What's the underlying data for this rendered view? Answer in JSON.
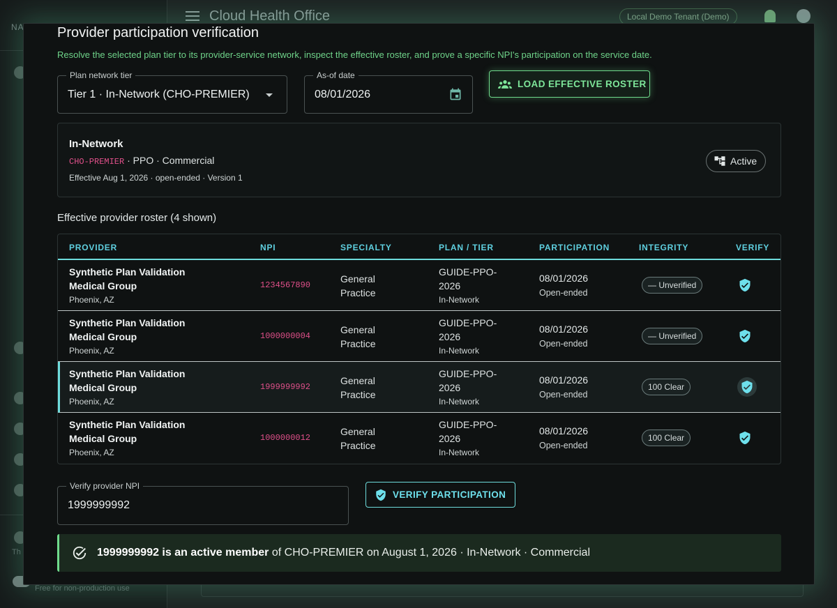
{
  "app": {
    "title": "Cloud Health Office",
    "tenant": "Local Demo Tenant (Demo)",
    "nav_label": "NA",
    "sidebar_footer_line1": "Th",
    "sidebar_footer_line2": "Free for non-production use"
  },
  "dialog": {
    "title": "Provider participation verification",
    "subtitle": "Resolve the selected plan tier to its provider-service network, inspect the effective roster, and prove a specific NPI's participation on the service date.",
    "plan_tier": {
      "label": "Plan network tier",
      "value": "Tier 1 · In-Network (CHO-PREMIER)"
    },
    "as_of": {
      "label": "As-of date",
      "value": "08/01/2026"
    },
    "load_button": "LOAD EFFECTIVE ROSTER",
    "network": {
      "name": "In-Network",
      "code": "CHO-PREMIER",
      "type_line": " · PPO · Commercial",
      "effective_line": "Effective Aug 1, 2026 · open-ended · Version 1",
      "status": "Active"
    },
    "roster_title": "Effective provider roster (4 shown)",
    "columns": [
      "PROVIDER",
      "NPI",
      "SPECIALTY",
      "PLAN / TIER",
      "PARTICIPATION",
      "INTEGRITY",
      "VERIFY"
    ],
    "rows": [
      {
        "name": "Synthetic Plan Validation Medical Group",
        "location": "Phoenix, AZ",
        "npi": "1234567890",
        "specialty": "General Practice",
        "plan": "GUIDE-PPO-2026",
        "tier": "In-Network",
        "date": "08/01/2026",
        "end": "Open-ended",
        "integrity": "— Unverified"
      },
      {
        "name": "Synthetic Plan Validation Medical Group",
        "location": "Phoenix, AZ",
        "npi": "1000000004",
        "specialty": "General Practice",
        "plan": "GUIDE-PPO-2026",
        "tier": "In-Network",
        "date": "08/01/2026",
        "end": "Open-ended",
        "integrity": "— Unverified"
      },
      {
        "name": "Synthetic Plan Validation Medical Group",
        "location": "Phoenix, AZ",
        "npi": "1999999992",
        "specialty": "General Practice",
        "plan": "GUIDE-PPO-2026",
        "tier": "In-Network",
        "date": "08/01/2026",
        "end": "Open-ended",
        "integrity": "100 Clear"
      },
      {
        "name": "Synthetic Plan Validation Medical Group",
        "location": "Phoenix, AZ",
        "npi": "1000000012",
        "specialty": "General Practice",
        "plan": "GUIDE-PPO-2026",
        "tier": "In-Network",
        "date": "08/01/2026",
        "end": "Open-ended",
        "integrity": "100 Clear"
      }
    ],
    "verify_npi": {
      "label": "Verify provider NPI",
      "value": "1999999992"
    },
    "verify_button": "VERIFY PARTICIPATION",
    "result": {
      "bold": "1999999992 is an active member",
      "rest": " of CHO-PREMIER on August 1, 2026 · In-Network · Commercial"
    }
  },
  "colors": {
    "accent_green": "#6fdc8c",
    "accent_cyan": "#6edcdc",
    "npi_pink": "#e0508a"
  }
}
